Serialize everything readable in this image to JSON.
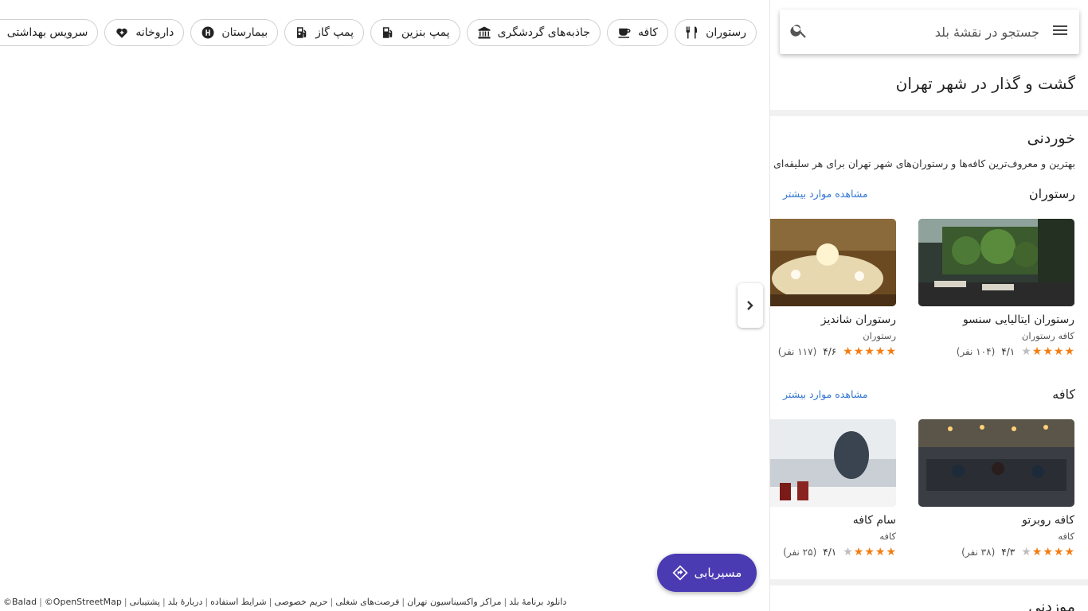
{
  "search": {
    "placeholder": "جستجو در نقشهٔ بلد"
  },
  "chips": [
    {
      "label": "رستوران",
      "icon": "utensils-icon"
    },
    {
      "label": "کافه",
      "icon": "coffee-icon"
    },
    {
      "label": "جاذبه‌های گردشگری",
      "icon": "museum-icon"
    },
    {
      "label": "پمپ بنزین",
      "icon": "fuel-icon"
    },
    {
      "label": "پمپ گاز",
      "icon": "gas-pump-icon"
    },
    {
      "label": "بیمارستان",
      "icon": "hospital-icon"
    },
    {
      "label": "داروخانه",
      "icon": "pharmacy-icon"
    },
    {
      "label": "سرویس بهداشتی",
      "icon": "restroom-icon"
    }
  ],
  "route_button": {
    "label": "مسیریابی",
    "icon": "directions-icon"
  },
  "footer": [
    "دانلود برنامهٔ بلد",
    "مراکز واکسیناسیون تهران",
    "فرصت‌های شغلی",
    "حریم خصوصی",
    "شرایط استفاده",
    "دربارهٔ بلد",
    "پشتیبانی",
    "©OpenStreetMap",
    "©Balad"
  ],
  "panel": {
    "title": "گشت و گذار در شهر تهران",
    "section": {
      "title": "خوردنی",
      "description": "بهترین و معروف‌ترین کافه‌ها و رستوران‌های شهر تهران برای هر سلیقه‌ای"
    },
    "more_label": "مشاهده موارد بیشتر",
    "categories": [
      {
        "title": "رستوران",
        "places": [
          {
            "name": "رستوران ایتالیایی سنسو",
            "type": "کافه رستوران",
            "score": "۴/۱",
            "count": "(۱۰۴ نفر)",
            "stars": 4
          },
          {
            "name": "رستوران شاندیز",
            "type": "رستوران",
            "score": "۴/۶",
            "count": "(۱۱۷ نفر)",
            "stars": 5
          }
        ]
      },
      {
        "title": "کافه",
        "places": [
          {
            "name": "کافه روبرتو",
            "type": "کافه",
            "score": "۴/۳",
            "count": "(۳۸ نفر)",
            "stars": 4
          },
          {
            "name": "سام کافه",
            "type": "کافه",
            "score": "۴/۱",
            "count": "(۲۵ نفر)",
            "stars": 4
          }
        ]
      }
    ],
    "next_section_title": "موزدنی"
  },
  "colors": {
    "accent": "#4a3bb3",
    "link": "#3577d4",
    "star": "#f47c10"
  }
}
